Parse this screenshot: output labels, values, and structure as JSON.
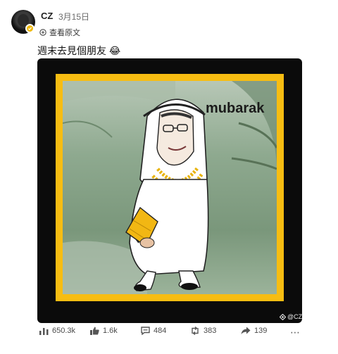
{
  "author": {
    "name": "CZ",
    "date": "3月15日",
    "avatar_icon": "avatar-portrait",
    "verified_icon": "verified-badge-icon",
    "verified_color": "#f0b90b"
  },
  "translate": {
    "label": "查看原文",
    "icon": "translate-icon"
  },
  "post": {
    "text": "週末去見個朋友 😂"
  },
  "media": {
    "caption": "mubarak",
    "watermark": "@CZ",
    "border_color": "#f7bd12",
    "frame_color": "#0b0b0b"
  },
  "actions": {
    "views": "650.3k",
    "likes": "1.6k",
    "comments": "484",
    "reposts": "383",
    "shares": "139",
    "more_label": "⋯"
  }
}
